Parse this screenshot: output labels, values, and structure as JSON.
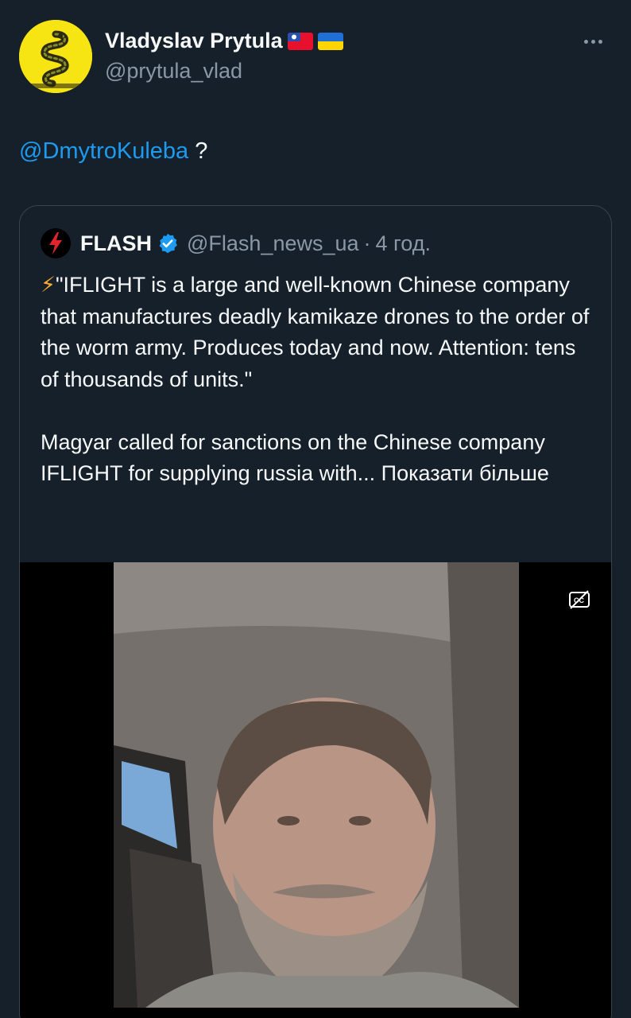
{
  "author": {
    "name": "Vladyslav Prytula",
    "handle": "@prytula_vlad",
    "avatar_icon": "gadsden-snake-avatar",
    "flags": [
      "taiwan-flag",
      "ukraine-flag"
    ]
  },
  "more_icon": "more-horizontal-icon",
  "tweet": {
    "mention": "@DmytroKuleba",
    "suffix": " ?"
  },
  "quote": {
    "name": "FLASH",
    "handle": "@Flash_news_ua",
    "separator": "·",
    "time": "4 год.",
    "verified_color": "#1d9bf0",
    "bolt": "⚡",
    "paragraph1": "\"IFLIGHT is a large and well-known Chinese company that manufactures deadly kamikaze drones to the order of the worm army. Produces today and now. Attention: tens of thousands of units.\"",
    "paragraph2": "Magyar called for sanctions on the Chinese company IFLIGHT for supplying russia with...",
    "show_more": "Показати більше"
  },
  "video": {
    "caption_icon": "closed-captions-off-icon"
  },
  "colors": {
    "background": "#15202b",
    "text": "#f7f9f9",
    "secondary": "#8b98a5",
    "link": "#1d9bf0",
    "border": "#38444d"
  }
}
